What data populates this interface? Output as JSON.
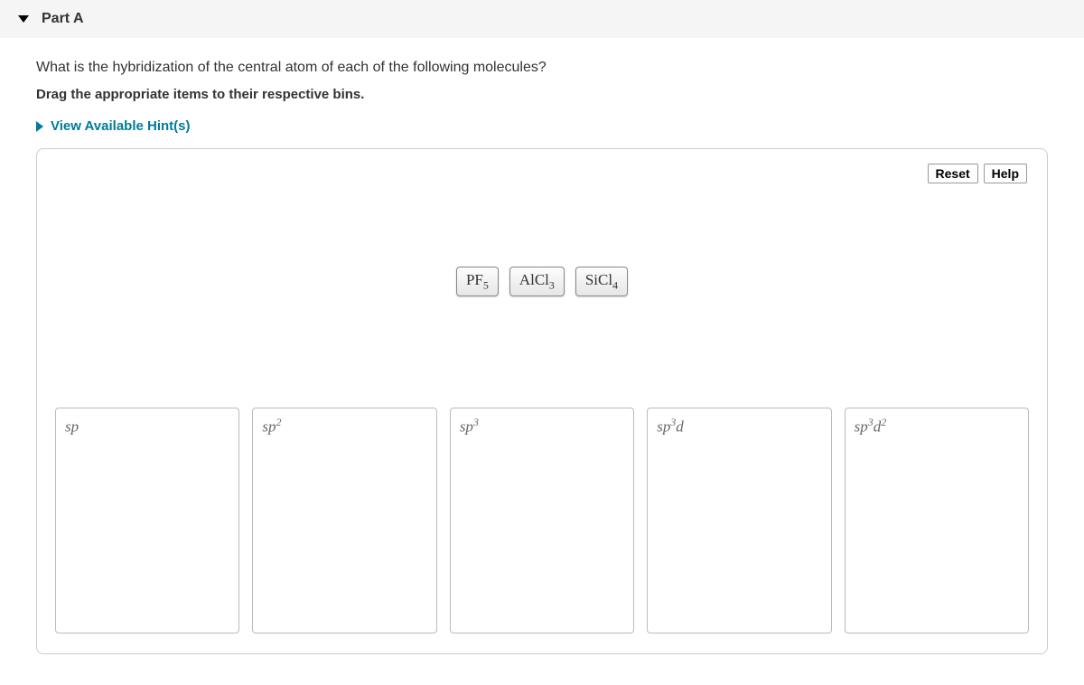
{
  "header": {
    "part_label": "Part A"
  },
  "question": {
    "text": "What is the hybridization of the central atom of each of the following molecules?",
    "instruction": "Drag the appropriate items to their respective bins.",
    "hints_label": "View Available Hint(s)"
  },
  "controls": {
    "reset": "Reset",
    "help": "Help"
  },
  "chart_data": {
    "type": "table",
    "draggables": [
      {
        "id": "pf5",
        "base": "PF",
        "sub": "5"
      },
      {
        "id": "alcl3",
        "base": "AlCl",
        "sub": "3"
      },
      {
        "id": "sicl4",
        "base": "SiCl",
        "sub": "4"
      }
    ],
    "bins": [
      {
        "id": "sp",
        "base": "sp",
        "sup": "",
        "extra_base": "",
        "extra_sup": ""
      },
      {
        "id": "sp2",
        "base": "sp",
        "sup": "2",
        "extra_base": "",
        "extra_sup": ""
      },
      {
        "id": "sp3",
        "base": "sp",
        "sup": "3",
        "extra_base": "",
        "extra_sup": ""
      },
      {
        "id": "sp3d",
        "base": "sp",
        "sup": "3",
        "extra_base": "d",
        "extra_sup": ""
      },
      {
        "id": "sp3d2",
        "base": "sp",
        "sup": "3",
        "extra_base": "d",
        "extra_sup": "2"
      }
    ]
  }
}
